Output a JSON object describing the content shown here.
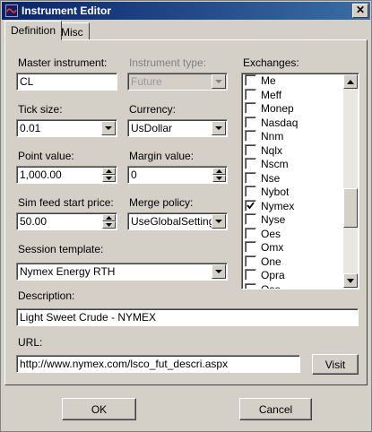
{
  "window": {
    "title": "Instrument Editor",
    "close_glyph": "✕"
  },
  "tabs": [
    {
      "label": "Definition",
      "active": true
    },
    {
      "label": "Misc",
      "active": false
    }
  ],
  "form": {
    "master_instrument": {
      "label": "Master instrument:",
      "value": "CL"
    },
    "instrument_type": {
      "label": "Instrument type:",
      "value": "Future",
      "disabled": true
    },
    "tick_size": {
      "label": "Tick size:",
      "value": "0.01"
    },
    "currency": {
      "label": "Currency:",
      "value": "UsDollar"
    },
    "point_value": {
      "label": "Point value:",
      "value": "1,000.00"
    },
    "margin_value": {
      "label": "Margin value:",
      "value": "0"
    },
    "sim_feed_start_price": {
      "label": "Sim feed start price:",
      "value": "50.00"
    },
    "merge_policy": {
      "label": "Merge policy:",
      "value": "UseGlobalSettings"
    },
    "session_template": {
      "label": "Session template:",
      "value": "Nymex Energy RTH"
    },
    "description": {
      "label": "Description:",
      "value": "Light Sweet Crude - NYMEX"
    },
    "url": {
      "label": "URL:",
      "value": "http://www.nymex.com/lsco_fut_descri.aspx"
    }
  },
  "exchanges": {
    "label": "Exchanges:",
    "items": [
      {
        "name": "Me",
        "checked": false
      },
      {
        "name": "Meff",
        "checked": false
      },
      {
        "name": "Monep",
        "checked": false
      },
      {
        "name": "Nasdaq",
        "checked": false
      },
      {
        "name": "Nnm",
        "checked": false
      },
      {
        "name": "Nqlx",
        "checked": false
      },
      {
        "name": "Nscm",
        "checked": false
      },
      {
        "name": "Nse",
        "checked": false
      },
      {
        "name": "Nybot",
        "checked": false
      },
      {
        "name": "Nymex",
        "checked": true
      },
      {
        "name": "Nyse",
        "checked": false
      },
      {
        "name": "Oes",
        "checked": false
      },
      {
        "name": "Omx",
        "checked": false
      },
      {
        "name": "One",
        "checked": false
      },
      {
        "name": "Opra",
        "checked": false
      },
      {
        "name": "Ose",
        "checked": false
      }
    ]
  },
  "buttons": {
    "visit": "Visit",
    "ok": "OK",
    "cancel": "Cancel"
  },
  "icons": {
    "app": "app-icon",
    "close": "close-icon",
    "dropdown": "chevron-down-icon",
    "spin_up": "arrow-up-icon",
    "spin_down": "arrow-down-icon",
    "check": "checkmark-icon"
  }
}
